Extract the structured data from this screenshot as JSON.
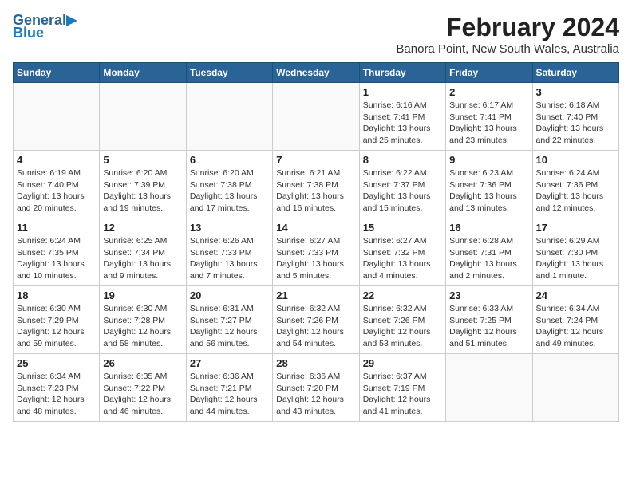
{
  "app": {
    "name": "GeneralBlue",
    "logo_text_general": "General",
    "logo_text_blue": "Blue"
  },
  "title": "February 2024",
  "subtitle": "Banora Point, New South Wales, Australia",
  "days_of_week": [
    "Sunday",
    "Monday",
    "Tuesday",
    "Wednesday",
    "Thursday",
    "Friday",
    "Saturday"
  ],
  "weeks": [
    [
      {
        "day": "",
        "info": ""
      },
      {
        "day": "",
        "info": ""
      },
      {
        "day": "",
        "info": ""
      },
      {
        "day": "",
        "info": ""
      },
      {
        "day": "1",
        "info": "Sunrise: 6:16 AM\nSunset: 7:41 PM\nDaylight: 13 hours\nand 25 minutes."
      },
      {
        "day": "2",
        "info": "Sunrise: 6:17 AM\nSunset: 7:41 PM\nDaylight: 13 hours\nand 23 minutes."
      },
      {
        "day": "3",
        "info": "Sunrise: 6:18 AM\nSunset: 7:40 PM\nDaylight: 13 hours\nand 22 minutes."
      }
    ],
    [
      {
        "day": "4",
        "info": "Sunrise: 6:19 AM\nSunset: 7:40 PM\nDaylight: 13 hours\nand 20 minutes."
      },
      {
        "day": "5",
        "info": "Sunrise: 6:20 AM\nSunset: 7:39 PM\nDaylight: 13 hours\nand 19 minutes."
      },
      {
        "day": "6",
        "info": "Sunrise: 6:20 AM\nSunset: 7:38 PM\nDaylight: 13 hours\nand 17 minutes."
      },
      {
        "day": "7",
        "info": "Sunrise: 6:21 AM\nSunset: 7:38 PM\nDaylight: 13 hours\nand 16 minutes."
      },
      {
        "day": "8",
        "info": "Sunrise: 6:22 AM\nSunset: 7:37 PM\nDaylight: 13 hours\nand 15 minutes."
      },
      {
        "day": "9",
        "info": "Sunrise: 6:23 AM\nSunset: 7:36 PM\nDaylight: 13 hours\nand 13 minutes."
      },
      {
        "day": "10",
        "info": "Sunrise: 6:24 AM\nSunset: 7:36 PM\nDaylight: 13 hours\nand 12 minutes."
      }
    ],
    [
      {
        "day": "11",
        "info": "Sunrise: 6:24 AM\nSunset: 7:35 PM\nDaylight: 13 hours\nand 10 minutes."
      },
      {
        "day": "12",
        "info": "Sunrise: 6:25 AM\nSunset: 7:34 PM\nDaylight: 13 hours\nand 9 minutes."
      },
      {
        "day": "13",
        "info": "Sunrise: 6:26 AM\nSunset: 7:33 PM\nDaylight: 13 hours\nand 7 minutes."
      },
      {
        "day": "14",
        "info": "Sunrise: 6:27 AM\nSunset: 7:33 PM\nDaylight: 13 hours\nand 5 minutes."
      },
      {
        "day": "15",
        "info": "Sunrise: 6:27 AM\nSunset: 7:32 PM\nDaylight: 13 hours\nand 4 minutes."
      },
      {
        "day": "16",
        "info": "Sunrise: 6:28 AM\nSunset: 7:31 PM\nDaylight: 13 hours\nand 2 minutes."
      },
      {
        "day": "17",
        "info": "Sunrise: 6:29 AM\nSunset: 7:30 PM\nDaylight: 13 hours\nand 1 minute."
      }
    ],
    [
      {
        "day": "18",
        "info": "Sunrise: 6:30 AM\nSunset: 7:29 PM\nDaylight: 12 hours\nand 59 minutes."
      },
      {
        "day": "19",
        "info": "Sunrise: 6:30 AM\nSunset: 7:28 PM\nDaylight: 12 hours\nand 58 minutes."
      },
      {
        "day": "20",
        "info": "Sunrise: 6:31 AM\nSunset: 7:27 PM\nDaylight: 12 hours\nand 56 minutes."
      },
      {
        "day": "21",
        "info": "Sunrise: 6:32 AM\nSunset: 7:26 PM\nDaylight: 12 hours\nand 54 minutes."
      },
      {
        "day": "22",
        "info": "Sunrise: 6:32 AM\nSunset: 7:26 PM\nDaylight: 12 hours\nand 53 minutes."
      },
      {
        "day": "23",
        "info": "Sunrise: 6:33 AM\nSunset: 7:25 PM\nDaylight: 12 hours\nand 51 minutes."
      },
      {
        "day": "24",
        "info": "Sunrise: 6:34 AM\nSunset: 7:24 PM\nDaylight: 12 hours\nand 49 minutes."
      }
    ],
    [
      {
        "day": "25",
        "info": "Sunrise: 6:34 AM\nSunset: 7:23 PM\nDaylight: 12 hours\nand 48 minutes."
      },
      {
        "day": "26",
        "info": "Sunrise: 6:35 AM\nSunset: 7:22 PM\nDaylight: 12 hours\nand 46 minutes."
      },
      {
        "day": "27",
        "info": "Sunrise: 6:36 AM\nSunset: 7:21 PM\nDaylight: 12 hours\nand 44 minutes."
      },
      {
        "day": "28",
        "info": "Sunrise: 6:36 AM\nSunset: 7:20 PM\nDaylight: 12 hours\nand 43 minutes."
      },
      {
        "day": "29",
        "info": "Sunrise: 6:37 AM\nSunset: 7:19 PM\nDaylight: 12 hours\nand 41 minutes."
      },
      {
        "day": "",
        "info": ""
      },
      {
        "day": "",
        "info": ""
      }
    ]
  ]
}
